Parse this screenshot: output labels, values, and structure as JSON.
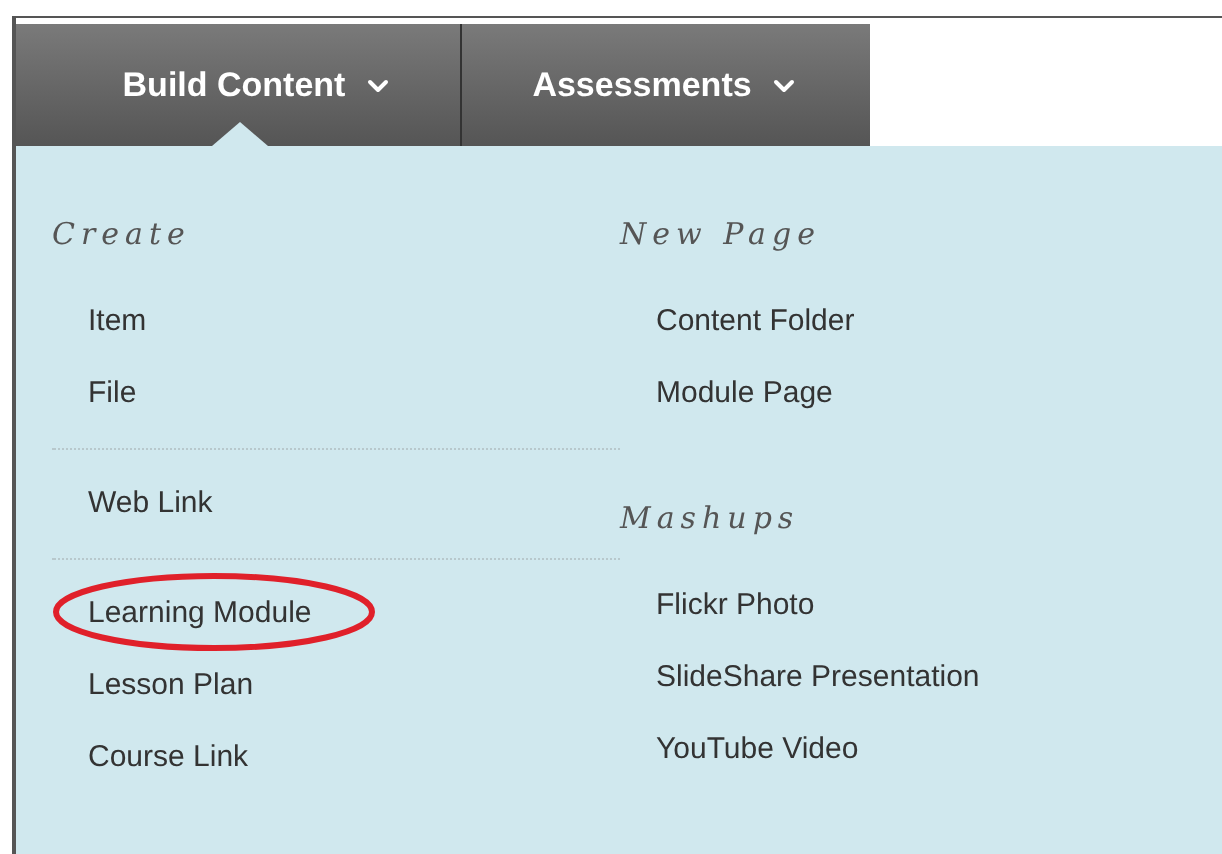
{
  "tabs": [
    {
      "label": "Build Content",
      "selected": true
    },
    {
      "label": "Assessments",
      "selected": false
    }
  ],
  "menu": {
    "columns": [
      {
        "sections": [
          {
            "heading": "Create",
            "groups": [
              [
                {
                  "label": "Item",
                  "circled": false
                },
                {
                  "label": "File",
                  "circled": false
                }
              ],
              [
                {
                  "label": "Web Link",
                  "circled": false
                }
              ],
              [
                {
                  "label": "Learning Module",
                  "circled": true
                },
                {
                  "label": "Lesson Plan",
                  "circled": false
                },
                {
                  "label": "Course Link",
                  "circled": false
                }
              ]
            ]
          }
        ]
      },
      {
        "sections": [
          {
            "heading": "New Page",
            "groups": [
              [
                {
                  "label": "Content Folder",
                  "circled": false
                },
                {
                  "label": "Module Page",
                  "circled": false
                }
              ]
            ]
          },
          {
            "heading": "Mashups",
            "groups": [
              [
                {
                  "label": "Flickr Photo",
                  "circled": false
                },
                {
                  "label": "SlideShare Presentation",
                  "circled": false
                },
                {
                  "label": "YouTube Video",
                  "circled": false
                }
              ]
            ]
          }
        ]
      }
    ]
  }
}
